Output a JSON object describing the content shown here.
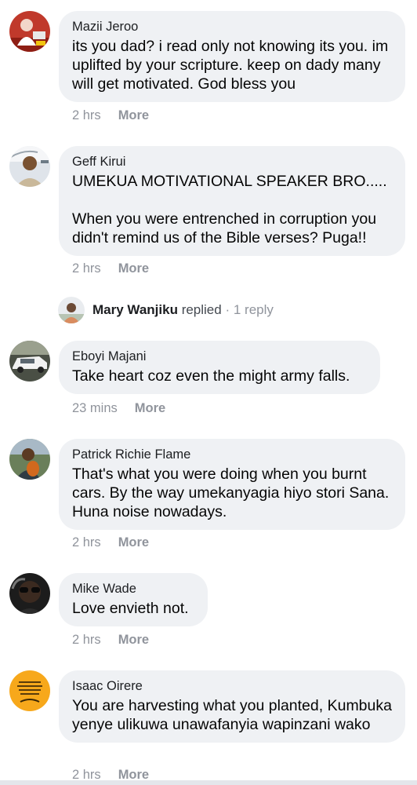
{
  "comments": [
    {
      "author": "Mazii Jeroo",
      "text": "its you dad? i read only not knowing its you. im uplifted by your scripture. keep on dady many will get motivated. God bless you",
      "time": "2 hrs",
      "more": "More"
    },
    {
      "author": "Geff Kirui",
      "text": "UMEKUA MOTIVATIONAL SPEAKER BRO.....\n\nWhen you were entrenched in corruption you didn't remind us of the Bible verses? Puga!!",
      "time": "2 hrs",
      "more": "More"
    },
    {
      "author": "Eboyi Majani",
      "text": "Take heart coz even the might army falls.",
      "time": "23 mins",
      "more": "More"
    },
    {
      "author": "Patrick Richie Flame",
      "text": "That's what you were doing when you burnt cars. By the way umekanyagia hiyo stori Sana. Huna noise nowadays.",
      "time": "2 hrs",
      "more": "More"
    },
    {
      "author": "Mike Wade",
      "text": "Love envieth not.",
      "time": "2 hrs",
      "more": "More"
    },
    {
      "author": "Isaac Oirere",
      "text": "You are harvesting what you planted, Kumbuka yenye ulikuwa unawafanyia wapinzani wako",
      "time": "2 hrs",
      "more": "More"
    }
  ],
  "reply_summary": {
    "name": "Mary Wanjiku",
    "action": "replied",
    "separator": "·",
    "count": "1 reply"
  },
  "avatar_icons": [
    "red-figure-avatar-icon",
    "man-portrait-avatar-icon",
    "woman-portrait-avatar-icon",
    "white-car-avatar-icon",
    "man-guitar-avatar-icon",
    "man-sunglasses-avatar-icon",
    "quote-poster-avatar-icon"
  ],
  "colors": {
    "bubble": "#eff1f4",
    "meta_text": "#90949c",
    "name_text": "#1c1e21",
    "quote_avatar": "#f7a81b"
  }
}
